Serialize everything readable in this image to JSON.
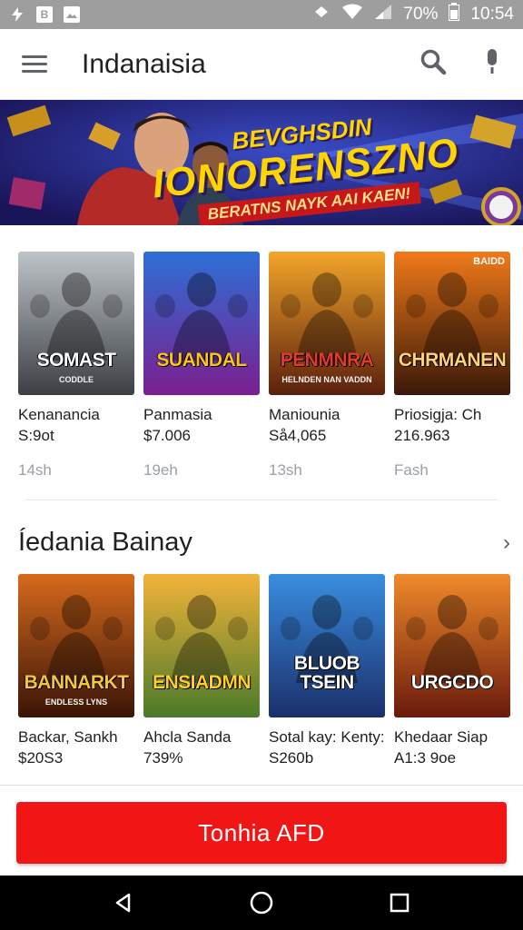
{
  "status_bar": {
    "battery_percent": "70%",
    "time": "10:54"
  },
  "app_bar": {
    "title": "Indanaisia"
  },
  "banner": {
    "top_line": "BEVGHSDIN",
    "headline": "IONORENSZNO",
    "subline": "BERATNS NAYK AAI KAEN!",
    "colors": {
      "bg_dark": "#1a1458",
      "bg_light": "#3a4dc8",
      "accent": "#ffd400",
      "sub_bg": "#c61818"
    }
  },
  "section_one": {
    "items": [
      {
        "art_title": "SOMAST",
        "art_sub": "CODDLE",
        "name": "Kenanancia",
        "price": "S:9ot",
        "size": "14sh",
        "colors": {
          "top": "#bfc4c8",
          "bottom": "#3b3f44",
          "text": "#ffffff"
        }
      },
      {
        "art_title": "SUANDAL",
        "art_sub": "",
        "name": "Panmasia",
        "price": "$7.006",
        "size": "19eh",
        "colors": {
          "top": "#2d6fd6",
          "bottom": "#7b1f8f",
          "text": "#ffc21a"
        }
      },
      {
        "art_title": "PENMNRA",
        "art_sub": "HELNDEN NAN VADDN",
        "name": "Maniounia",
        "price": "Så4,065",
        "size": "13sh",
        "colors": {
          "top": "#f4a62a",
          "bottom": "#5a1f0c",
          "text": "#e23a2a"
        }
      },
      {
        "art_title": "CHRMANEN",
        "art_sub": "",
        "art_corner": "BAIDD",
        "name": "Priosigja: Ch",
        "price": "216.963",
        "size": "Fash",
        "colors": {
          "top": "#f07a1a",
          "bottom": "#3a1808",
          "text": "#ffd27a"
        }
      }
    ]
  },
  "section_two": {
    "title": "Íedania Bainay",
    "more_label": "›",
    "items": [
      {
        "art_title": "BANNARKT",
        "art_sub": "ENDLESS LYNS",
        "name": "Backar, Sankh",
        "price": "$20S3",
        "colors": {
          "top": "#d66a1c",
          "bottom": "#3a1406",
          "text": "#f5c542"
        }
      },
      {
        "art_title": "ENSIADMN",
        "art_sub": "",
        "name": "Ahcla Sanda",
        "price": "739%",
        "colors": {
          "top": "#f2b33a",
          "bottom": "#4a7a2a",
          "text": "#ffcf2a"
        }
      },
      {
        "art_title": "BLUOB TSEIN",
        "art_sub": "",
        "name": "Sotal kay: Kenty:",
        "price": "S260b",
        "colors": {
          "top": "#3a8de0",
          "bottom": "#1a2f6a",
          "text": "#ffffff"
        }
      },
      {
        "art_title": "URGCDO",
        "art_sub": "",
        "name": "Khedaar Siap",
        "price": "A1:3 9oe",
        "colors": {
          "top": "#f08a2a",
          "bottom": "#6a1a0c",
          "text": "#ffffff"
        }
      }
    ]
  },
  "install_button": {
    "label": "Tonhia AFD",
    "color": "#f01616"
  }
}
